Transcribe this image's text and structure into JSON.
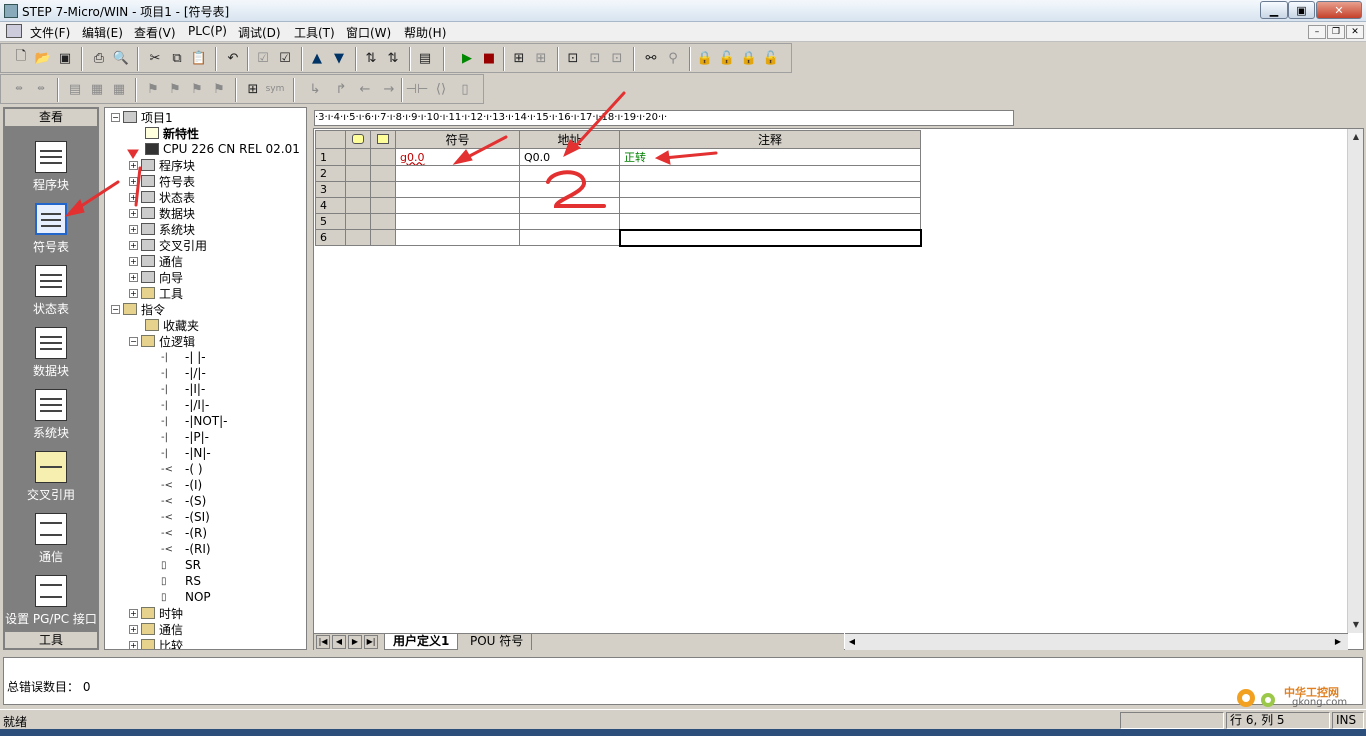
{
  "window": {
    "title": "STEP 7-Micro/WIN - 项目1 - [符号表]",
    "min": "▁",
    "max": "▣",
    "close": "✕"
  },
  "menu": [
    "文件(F)",
    "编辑(E)",
    "查看(V)",
    "PLC(P)",
    "调试(D)",
    "工具(T)",
    "窗口(W)",
    "帮助(H)"
  ],
  "mdi": {
    "min": "–",
    "restore": "❐",
    "close": "✕"
  },
  "navbar": {
    "header": "查看",
    "footer": "工具",
    "items": [
      {
        "label": "程序块",
        "icon": "program-block-icon"
      },
      {
        "label": "符号表",
        "icon": "symbol-table-icon",
        "selected": true
      },
      {
        "label": "状态表",
        "icon": "status-table-icon"
      },
      {
        "label": "数据块",
        "icon": "data-block-icon"
      },
      {
        "label": "系统块",
        "icon": "system-block-icon"
      },
      {
        "label": "交叉引用",
        "icon": "cross-reference-icon"
      },
      {
        "label": "通信",
        "icon": "communication-icon"
      },
      {
        "label": "设置 PG/PC 接口",
        "icon": "pg-pc-interface-icon"
      }
    ]
  },
  "tree": {
    "root": "项目1",
    "new_features": "新特性",
    "cpu": "CPU 226 CN REL 02.01",
    "project_items": [
      "程序块",
      "符号表",
      "状态表",
      "数据块",
      "系统块",
      "交叉引用",
      "通信",
      "向导",
      "工具"
    ],
    "instructions": "指令",
    "favorites": "收藏夹",
    "bit_logic": "位逻辑",
    "bit_items": [
      {
        "pre": "-|",
        "name": "-| |-"
      },
      {
        "pre": "-|",
        "name": "-|/|-"
      },
      {
        "pre": "-|",
        "name": "-|I|-"
      },
      {
        "pre": "-|",
        "name": "-|/I|-"
      },
      {
        "pre": "-|",
        "name": "-|NOT|-"
      },
      {
        "pre": "-|",
        "name": "-|P|-"
      },
      {
        "pre": "-|",
        "name": "-|N|-"
      },
      {
        "pre": "-<",
        "name": "-( )"
      },
      {
        "pre": "-<",
        "name": "-(I)"
      },
      {
        "pre": "-<",
        "name": "-(S)"
      },
      {
        "pre": "-<",
        "name": "-(SI)"
      },
      {
        "pre": "-<",
        "name": "-(R)"
      },
      {
        "pre": "-<",
        "name": "-(RI)"
      },
      {
        "pre": "▯",
        "name": "SR"
      },
      {
        "pre": "▯",
        "name": "RS"
      },
      {
        "pre": "▯",
        "name": "NOP"
      }
    ],
    "after": [
      "时钟",
      "通信",
      "比较"
    ]
  },
  "ruler": "·3·ı·4·ı·5·ı·6·ı·7·ı·8·ı·9·ı·10·ı·11·ı·12·ı·13·ı·14·ı·15·ı·16·ı·17·ı·18·ı·19·ı·20·ı·",
  "symtable": {
    "headers": [
      "符号",
      "地址",
      "注释"
    ],
    "rows": [
      {
        "n": "1",
        "symbol": "g0.0",
        "address": "Q0.0",
        "comment": "正转"
      },
      {
        "n": "2",
        "symbol": "",
        "address": "",
        "comment": ""
      },
      {
        "n": "3",
        "symbol": "",
        "address": "",
        "comment": ""
      },
      {
        "n": "4",
        "symbol": "",
        "address": "",
        "comment": ""
      },
      {
        "n": "5",
        "symbol": "",
        "address": "",
        "comment": ""
      },
      {
        "n": "6",
        "symbol": "",
        "address": "",
        "comment": ""
      }
    ]
  },
  "tabs": [
    "用户定义1",
    "POU 符号"
  ],
  "output": {
    "text": "总错误数目： 0"
  },
  "status": {
    "left": "就绪",
    "pos": "行 6, 列 5",
    "mode": "INS"
  },
  "annotation": {
    "number": "2",
    "mark": "1"
  },
  "watermark": {
    "line1": "中华工控网",
    "line2": "gkong.com"
  },
  "colors": {
    "accent": "#e33030",
    "comment_green": "#008000",
    "symbol_red": "#c00000"
  }
}
